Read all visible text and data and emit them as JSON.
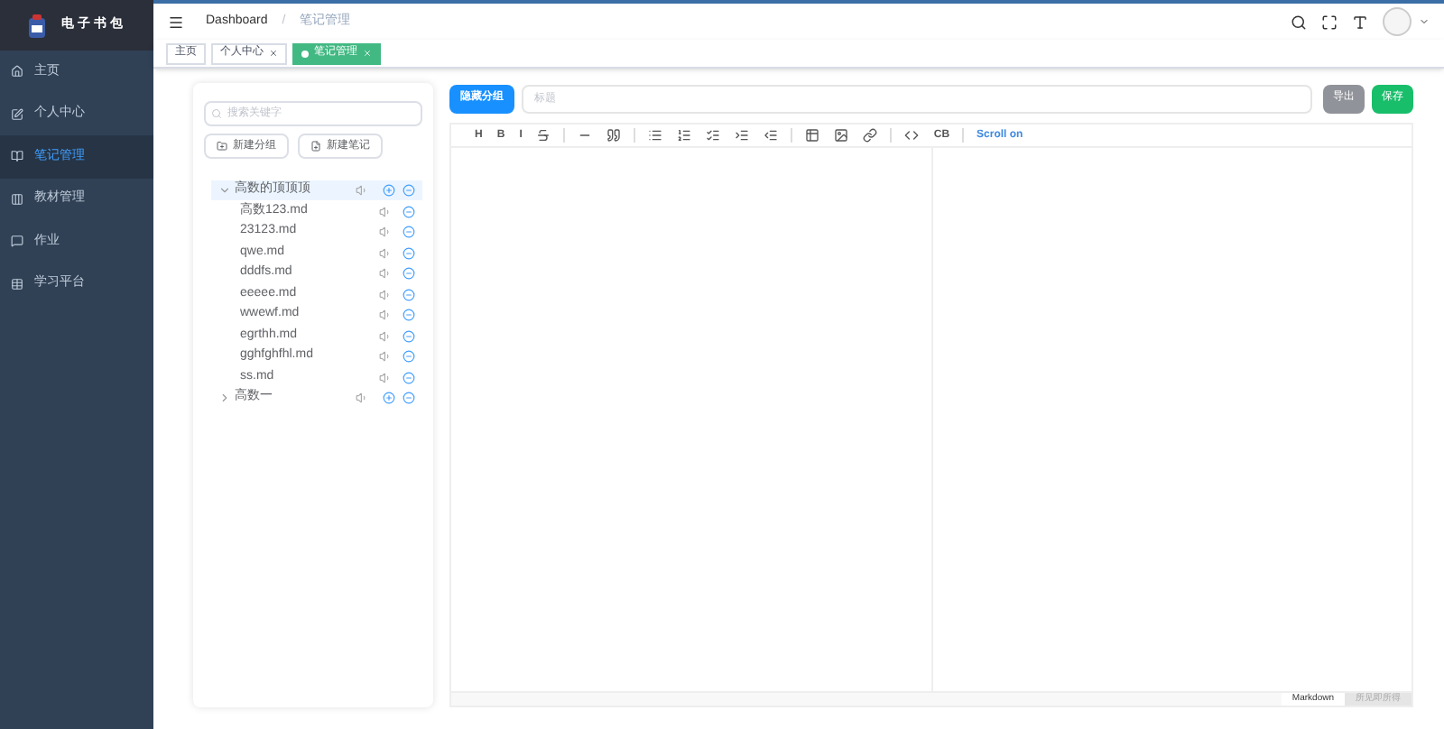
{
  "sidebar": {
    "logo_text": "电子书包",
    "items": [
      {
        "label": "主页",
        "selected": false
      },
      {
        "label": "个人中心",
        "selected": false
      },
      {
        "label": "笔记管理",
        "selected": true
      },
      {
        "label": "教材管理",
        "selected": false
      },
      {
        "label": "作业",
        "selected": false
      },
      {
        "label": "学习平台",
        "selected": false
      }
    ]
  },
  "breadcrumb": [
    "Dashboard",
    "/",
    "笔记管理"
  ],
  "tags": [
    {
      "label": "主页",
      "selected": false,
      "closable": false
    },
    {
      "label": "个人中心",
      "selected": false,
      "closable": true
    },
    {
      "label": "笔记管理",
      "selected": true,
      "closable": true
    }
  ],
  "notes_panel": {
    "search": {
      "placeholder": "搜索关键字"
    },
    "buttons": [
      "新建分组",
      "新建笔记"
    ],
    "tree": [
      {
        "label": "高数的顶顶顶",
        "kind": "folder",
        "expanded": true,
        "selected": true,
        "children": [
          {
            "label": "高数123.md",
            "kind": "file",
            "selected": false
          },
          {
            "label": "23123.md",
            "kind": "file",
            "selected": false
          },
          {
            "label": "qwe.md",
            "kind": "file",
            "selected": false
          },
          {
            "label": "dddfs.md",
            "kind": "file",
            "selected": false
          },
          {
            "label": "eeeee.md",
            "kind": "file",
            "selected": false
          },
          {
            "label": "wwewf.md",
            "kind": "file",
            "selected": false
          },
          {
            "label": "egrthh.md",
            "kind": "file",
            "selected": false
          },
          {
            "label": "gghfghfhl.md",
            "kind": "file",
            "selected": false
          },
          {
            "label": "ss.md",
            "kind": "file",
            "selected": false
          }
        ]
      },
      {
        "label": "高数一",
        "kind": "folder",
        "expanded": false,
        "selected": false
      }
    ]
  },
  "editor": {
    "hide_button": "隐藏分组",
    "title": {
      "placeholder": "标题"
    },
    "export_button": "导出",
    "save_button": "保存",
    "toolbar": [
      "H",
      "B",
      "I",
      "CB",
      "Scroll on"
    ],
    "mode_tabs": [
      {
        "label": "Markdown",
        "selected": true
      },
      {
        "label": "所见即所得",
        "selected": false
      }
    ]
  }
}
